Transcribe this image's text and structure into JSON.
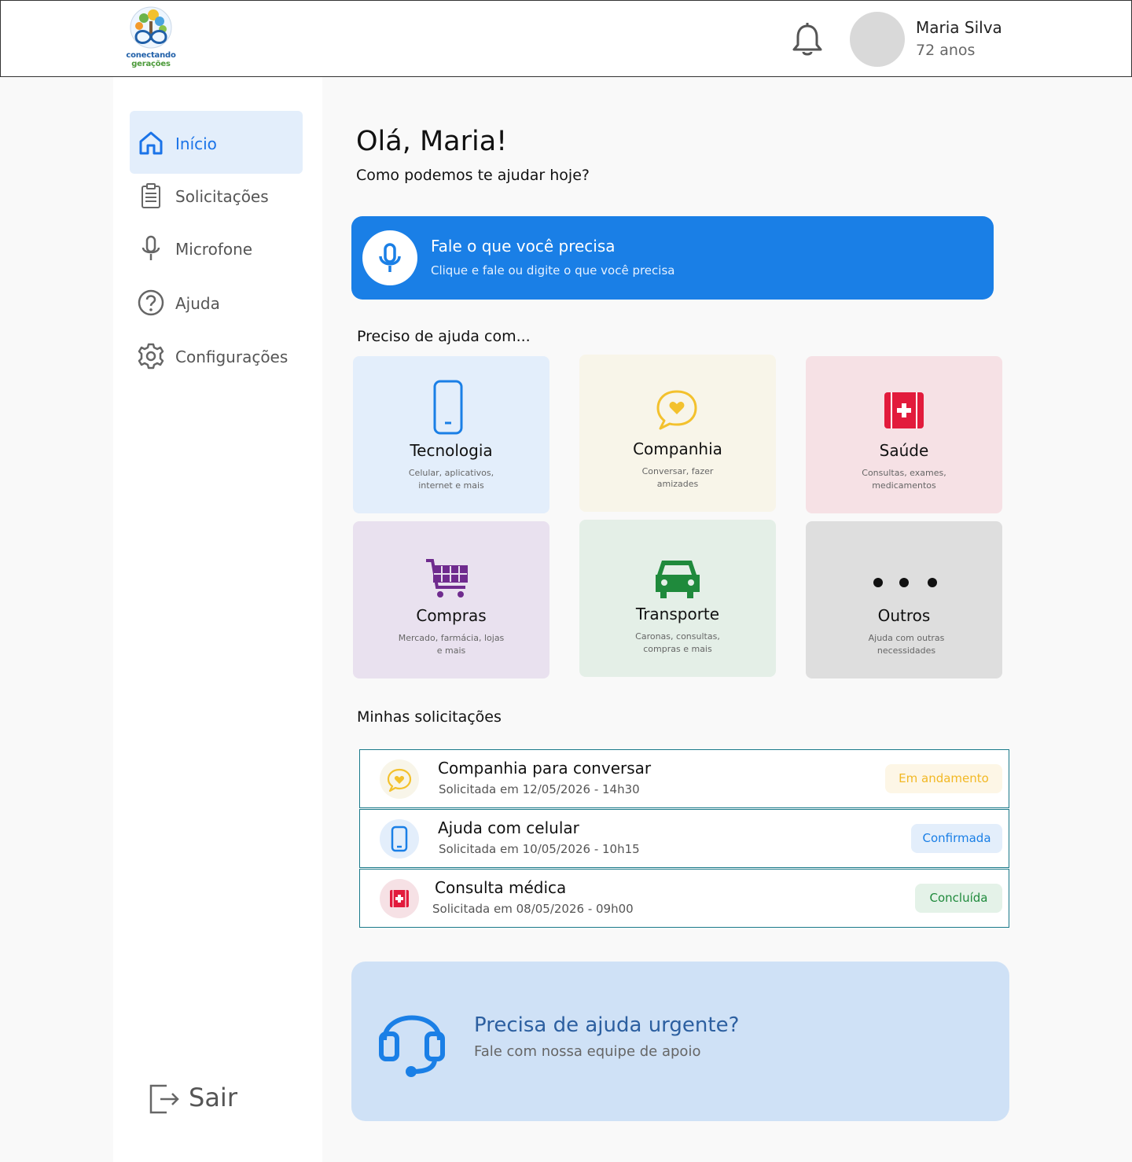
{
  "header": {
    "logo_line1": "conectando",
    "logo_line2": "gerações",
    "user_name": "Maria Silva",
    "user_age": "72 anos"
  },
  "sidebar": {
    "items": [
      {
        "label": "Início",
        "icon": "home-icon",
        "active": true
      },
      {
        "label": "Solicitações",
        "icon": "clipboard-icon",
        "active": false
      },
      {
        "label": "Microfone",
        "icon": "microphone-icon",
        "active": false
      },
      {
        "label": "Ajuda",
        "icon": "help-icon",
        "active": false
      },
      {
        "label": "Configurações",
        "icon": "gear-icon",
        "active": false
      }
    ],
    "logout_label": "Sair"
  },
  "main": {
    "greeting": "Olá, Maria!",
    "subgreeting": "Como podemos te ajudar hoje?",
    "voice": {
      "title": "Fale o que você precisa",
      "subtitle": "Clique e fale ou digite o que você precisa"
    },
    "help_section_title": "Preciso de ajuda com...",
    "categories": [
      {
        "title": "Tecnologia",
        "desc": "Celular, aplicativos, internet e mais",
        "icon": "phone-icon",
        "bg": "#e3eefb",
        "color": "#1a7fe6"
      },
      {
        "title": "Companhia",
        "desc": "Conversar, fazer amizades",
        "icon": "chat-heart-icon",
        "bg": "#f8f5e9",
        "color": "#f3c12d"
      },
      {
        "title": "Saúde",
        "desc": "Consultas, exames, medicamentos",
        "icon": "medical-kit-icon",
        "bg": "#f6e1e5",
        "color": "#e21b3c"
      },
      {
        "title": "Compras",
        "desc": "Mercado, farmácia, lojas e mais",
        "icon": "cart-icon",
        "bg": "#e9e1ef",
        "color": "#6f2b8e"
      },
      {
        "title": "Transporte",
        "desc": "Caronas, consultas, compras e mais",
        "icon": "car-icon",
        "bg": "#e4efe7",
        "color": "#1f8a3c"
      },
      {
        "title": "Outros",
        "desc": "Ajuda com outras necessidades",
        "icon": "more-icon",
        "bg": "#dedede",
        "color": "#111111"
      }
    ],
    "requests_title": "Minhas solicitações",
    "requests": [
      {
        "title": "Companhia para conversar",
        "date": "Solicitada em 12/05/2026 - 14h30",
        "status": "Em andamento",
        "icon": "chat-heart-icon"
      },
      {
        "title": "Ajuda com celular",
        "date": "Solicitada em 10/05/2026 - 10h15",
        "status": "Confirmada",
        "icon": "phone-icon"
      },
      {
        "title": "Consulta médica",
        "date": "Solicitada em 08/05/2026 - 09h00",
        "status": "Concluída",
        "icon": "medical-kit-icon"
      }
    ],
    "urgent": {
      "title": "Precisa de ajuda urgente?",
      "subtitle": "Fale com nossa equipe de apoio"
    }
  }
}
